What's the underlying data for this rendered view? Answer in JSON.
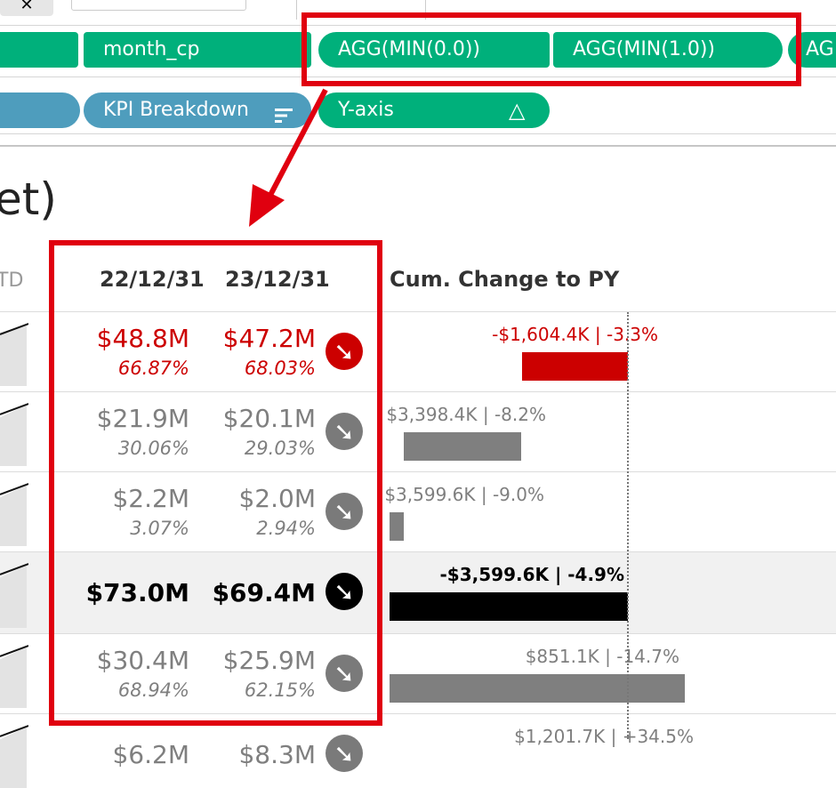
{
  "shelves": {
    "columns_pills": [
      "month_cp",
      "AGG(MIN(0.0))",
      "AGG(MIN(1.0))",
      "AG"
    ],
    "marks_pills": [
      "KPI Breakdown",
      "Y-axis"
    ]
  },
  "view": {
    "title_fragment": "et)",
    "column_headers": {
      "ytd_fragment": "TD",
      "col1": "22/12/31",
      "col2": "23/12/31",
      "change": "Cum. Change to PY"
    },
    "rows": [
      {
        "v1": "$48.8M",
        "p1": "66.87%",
        "v2": "$47.2M",
        "p2": "68.03%",
        "change_label": "-$1,604.4K | -3.3%",
        "change": -1604.4,
        "tone": "red"
      },
      {
        "v1": "$21.9M",
        "p1": "30.06%",
        "v2": "$20.1M",
        "p2": "29.03%",
        "change_label": "$3,398.4K | -8.2%",
        "change": -3398.4,
        "tone": "gray"
      },
      {
        "v1": "$2.2M",
        "p1": "3.07%",
        "v2": "$2.0M",
        "p2": "2.94%",
        "change_label": "$3,599.6K | -9.0%",
        "change": -3599.6,
        "tone": "gray"
      },
      {
        "v1": "$73.0M",
        "p1": "",
        "v2": "$69.4M",
        "p2": "",
        "change_label": "-$3,599.6K | -4.9%",
        "change": -3599.6,
        "tone": "black"
      },
      {
        "v1": "$30.4M",
        "p1": "68.94%",
        "v2": "$25.9M",
        "p2": "62.15%",
        "change_label": "$851.1K | -14.7%",
        "change": 851.1,
        "tone": "gray"
      },
      {
        "v1": "$6.2M",
        "p1": "",
        "v2": "$8.3M",
        "p2": "",
        "change_label": "$1,201.7K | +34.5%",
        "change": 1201.7,
        "tone": "gray"
      }
    ]
  },
  "colors": {
    "green_pill": "#00b07b",
    "blue_pill": "#4e9dbd",
    "red": "#cc0000",
    "gray": "#7f7f7f",
    "black": "#000000",
    "highlight": "#e0000f"
  },
  "icons": {
    "trend": "arrow-down-right-icon"
  }
}
